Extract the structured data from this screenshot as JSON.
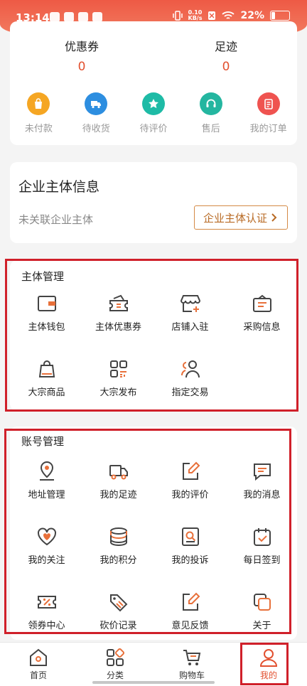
{
  "status_bar": {
    "time": "13:14",
    "net_speed_top": "0.10",
    "net_speed_bottom": "KB/s",
    "battery": "22%"
  },
  "stats": {
    "coupons_label": "优惠券",
    "coupons_value": "0",
    "footprint_label": "足迹",
    "footprint_value": "0"
  },
  "orders": [
    {
      "label": "未付款",
      "icon": "shopping-bag-icon",
      "color": "#f5a623"
    },
    {
      "label": "待收货",
      "icon": "truck-icon",
      "color": "#2d8ee0"
    },
    {
      "label": "待评价",
      "icon": "star-icon",
      "color": "#1ebba6"
    },
    {
      "label": "售后",
      "icon": "headset-icon",
      "color": "#24b6a0"
    },
    {
      "label": "我的订单",
      "icon": "clipboard-icon",
      "color": "#ef5350"
    }
  ],
  "enterprise": {
    "title": "企业主体信息",
    "subtitle": "未关联企业主体",
    "button": "企业主体认证"
  },
  "entity_management": {
    "title": "主体管理",
    "items": [
      {
        "label": "主体钱包",
        "icon": "wallet-icon"
      },
      {
        "label": "主体优惠券",
        "icon": "coupon-icon"
      },
      {
        "label": "店铺入驻",
        "icon": "store-icon"
      },
      {
        "label": "采购信息",
        "icon": "purchase-bag-icon"
      },
      {
        "label": "大宗商品",
        "icon": "goods-bag-icon"
      },
      {
        "label": "大宗发布",
        "icon": "grid-publish-icon"
      },
      {
        "label": "指定交易",
        "icon": "users-icon"
      }
    ]
  },
  "account_management": {
    "title": "账号管理",
    "items": [
      {
        "label": "地址管理",
        "icon": "location-icon"
      },
      {
        "label": "我的足迹",
        "icon": "truck-outline-icon"
      },
      {
        "label": "我的评价",
        "icon": "edit-icon"
      },
      {
        "label": "我的消息",
        "icon": "message-icon"
      },
      {
        "label": "我的关注",
        "icon": "heart-icon"
      },
      {
        "label": "我的积分",
        "icon": "coins-icon"
      },
      {
        "label": "我的投诉",
        "icon": "complaint-icon"
      },
      {
        "label": "每日签到",
        "icon": "calendar-check-icon"
      },
      {
        "label": "领券中心",
        "icon": "percent-ticket-icon"
      },
      {
        "label": "砍价记录",
        "icon": "price-tag-icon"
      },
      {
        "label": "意见反馈",
        "icon": "feedback-icon"
      },
      {
        "label": "关于",
        "icon": "about-icon"
      }
    ]
  },
  "tabbar": [
    {
      "label": "首页",
      "icon": "home-icon",
      "active": false
    },
    {
      "label": "分类",
      "icon": "category-icon",
      "active": false
    },
    {
      "label": "购物车",
      "icon": "cart-icon",
      "active": false
    },
    {
      "label": "我的",
      "icon": "user-icon",
      "active": true
    }
  ],
  "colors": {
    "accent": "#e2502f",
    "highlight_border": "#d0202a",
    "icon_orange": "#e8703a"
  }
}
